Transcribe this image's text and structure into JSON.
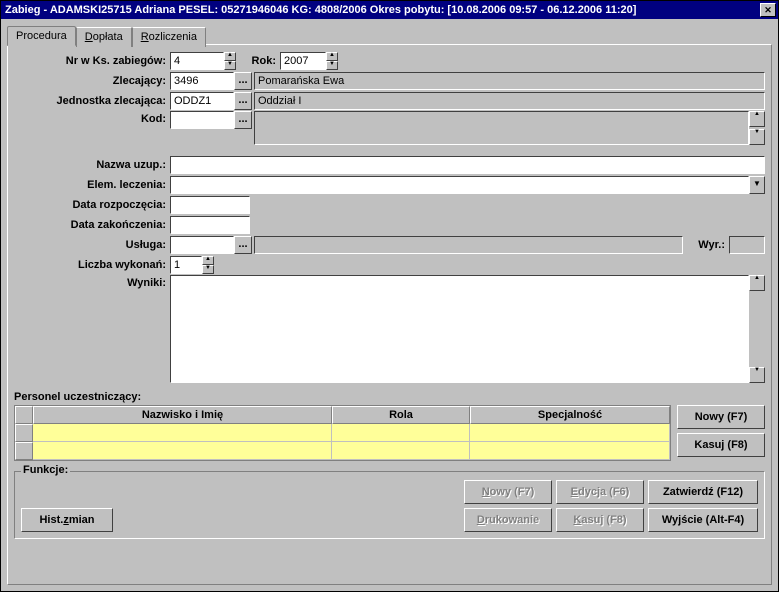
{
  "title": "Zabieg - ADAMSKI25715 Adriana PESEL: 05271946046 KG: 4808/2006 Okres pobytu: [10.08.2006 09:57 - 06.12.2006 11:20]",
  "tabs": {
    "procedura": "Procedura",
    "doplata": "Dopłata",
    "rozliczenia": "Rozliczenia"
  },
  "labels": {
    "nr": "Nr w Ks. zabiegów:",
    "rok": "Rok:",
    "zlecajacy": "Zlecający:",
    "jednostka": "Jednostka zlecająca:",
    "kod": "Kod:",
    "nazwa": "Nazwa uzup.:",
    "elem": "Elem. leczenia:",
    "dataRozp": "Data rozpoczęcia:",
    "dataZak": "Data zakończenia:",
    "usluga": "Usługa:",
    "wyr": "Wyr.:",
    "liczba": "Liczba wykonań:",
    "wyniki": "Wyniki:",
    "personel": "Personel uczestniczący:",
    "funkcje": "Funkcje:"
  },
  "values": {
    "nr": "4",
    "rok": "2007",
    "zlecajacy_code": "3496",
    "zlecajacy_name": "Pomarańska Ewa",
    "jednostka_code": "ODDZ1",
    "jednostka_name": "Oddział I",
    "kod": "",
    "kod_desc": "",
    "nazwa": "",
    "elem": "",
    "dataRozp": "",
    "dataZak": "",
    "usluga_code": "",
    "usluga_name": "",
    "wyr": "",
    "liczba": "1",
    "wyniki": ""
  },
  "grid": {
    "cols": {
      "nazwisko": "Nazwisko i Imię",
      "rola": "Rola",
      "spec": "Specjalność"
    }
  },
  "buttons": {
    "nowyF7": "Nowy (F7)",
    "kasujF8": "Kasuj (F8)",
    "edycjaF6": "Edycja (F6)",
    "drukowanie": "Drukowanie",
    "zatwierdz": "Zatwierdź (F12)",
    "wyjscie": "Wyjście (Alt-F4)",
    "hist": "Hist. zmian"
  }
}
